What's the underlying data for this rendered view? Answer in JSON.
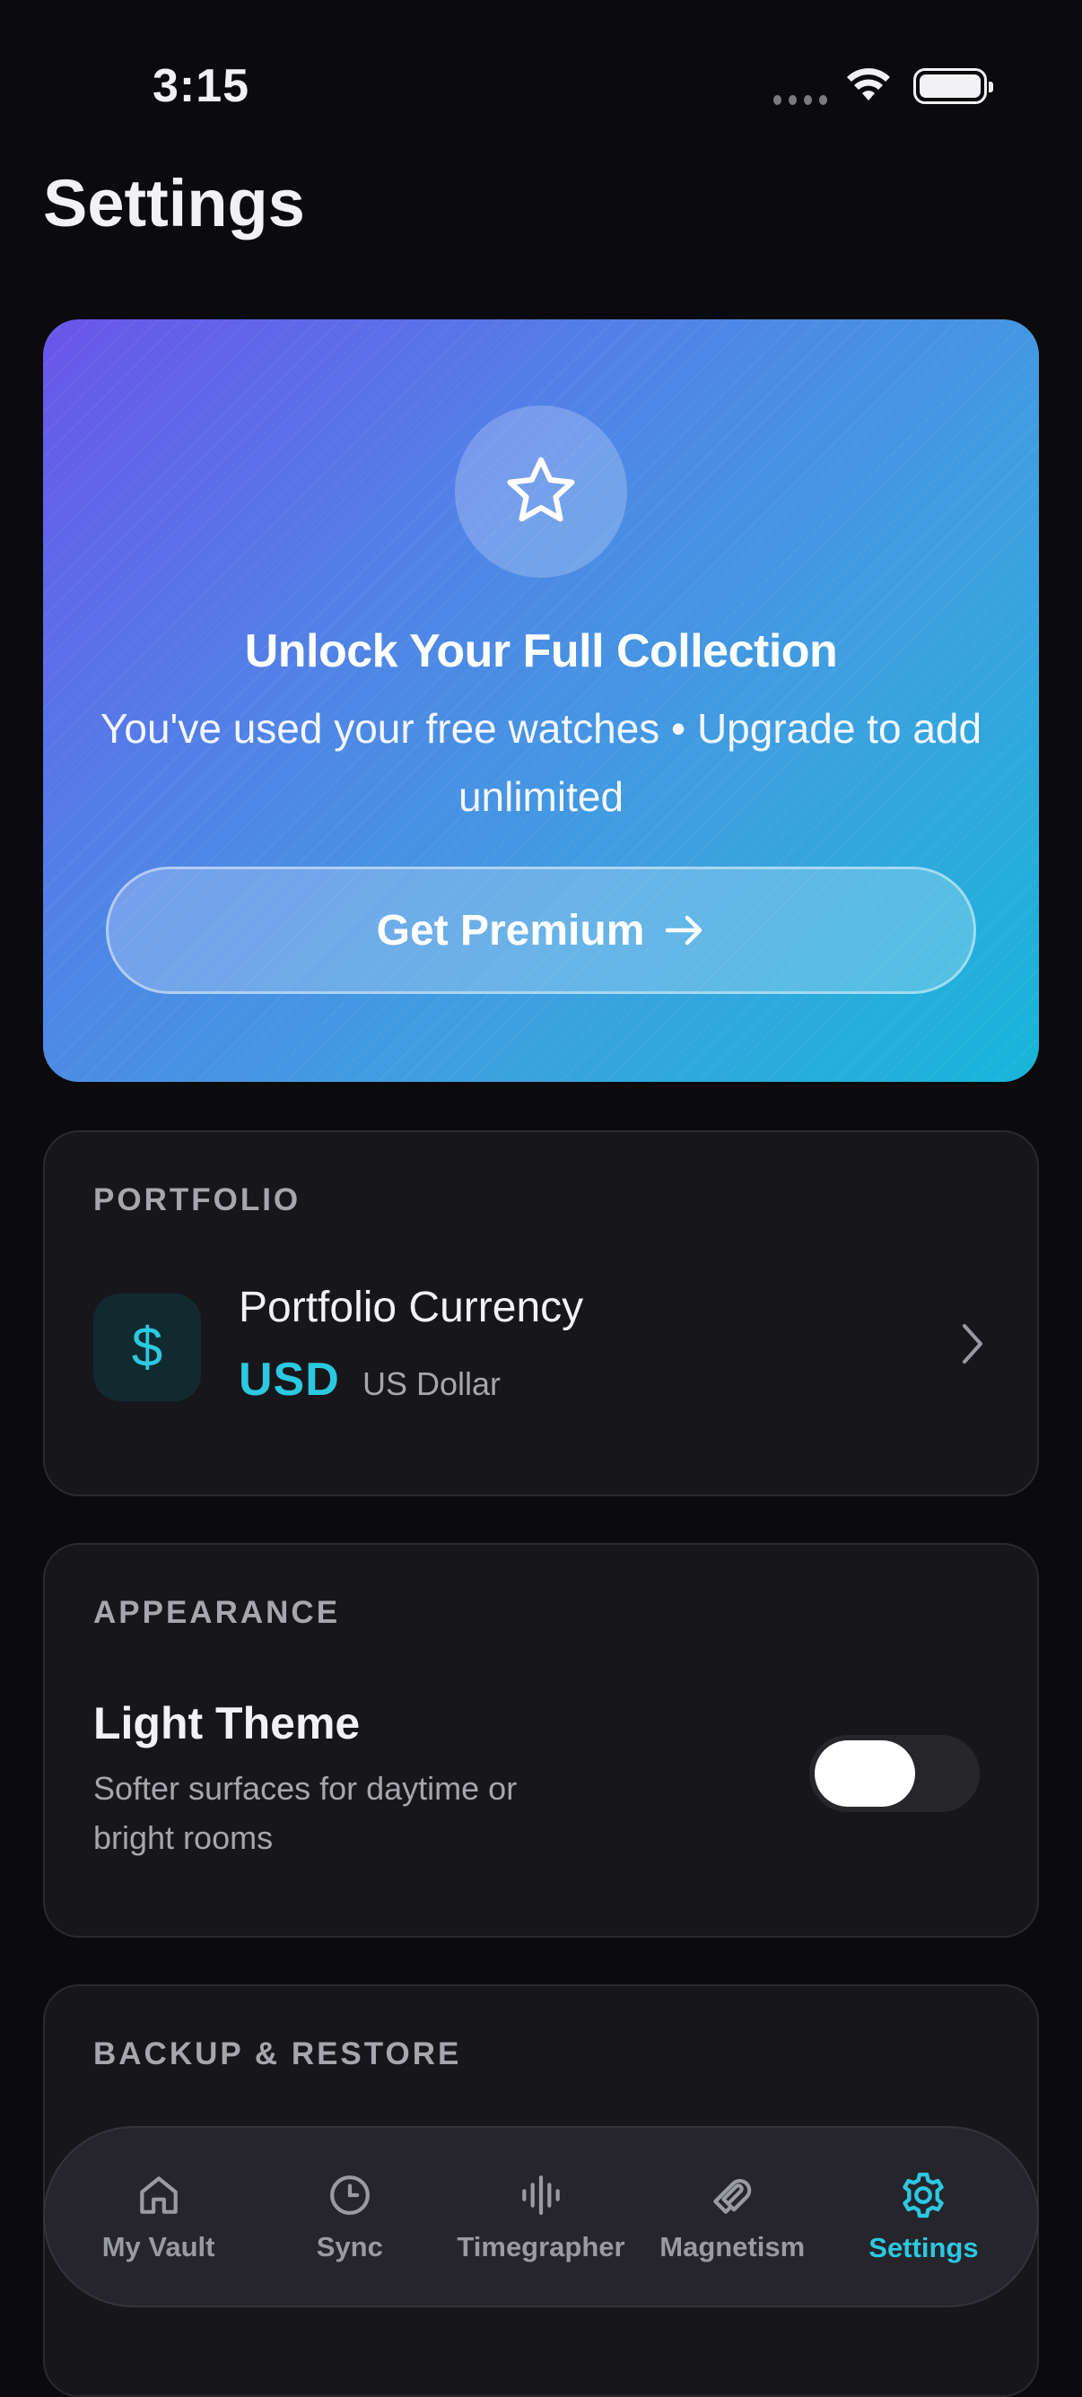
{
  "status_bar": {
    "time": "3:15"
  },
  "page": {
    "title": "Settings"
  },
  "promo": {
    "title": "Unlock Your Full Collection",
    "subtitle": "You've used your free watches • Upgrade to add unlimited",
    "button_label": "Get Premium",
    "icon": "star-icon"
  },
  "portfolio": {
    "section_label": "PORTFOLIO",
    "row_title": "Portfolio Currency",
    "currency_code": "USD",
    "currency_name": "US Dollar",
    "currency_symbol": "$"
  },
  "appearance": {
    "section_label": "APPEARANCE",
    "theme_title": "Light Theme",
    "theme_subtitle": "Softer surfaces for daytime or bright rooms",
    "toggle_on": false
  },
  "backup": {
    "section_label": "BACKUP & RESTORE"
  },
  "tabs": [
    {
      "label": "My Vault",
      "icon": "home-icon",
      "active": false
    },
    {
      "label": "Sync",
      "icon": "clock-icon",
      "active": false
    },
    {
      "label": "Timegrapher",
      "icon": "waveform-icon",
      "active": false
    },
    {
      "label": "Magnetism",
      "icon": "magnet-icon",
      "active": false
    },
    {
      "label": "Settings",
      "icon": "gear-icon",
      "active": true
    }
  ],
  "colors": {
    "accent": "#2cc8e0",
    "background": "#0b0b0d",
    "card": "#17171b"
  }
}
